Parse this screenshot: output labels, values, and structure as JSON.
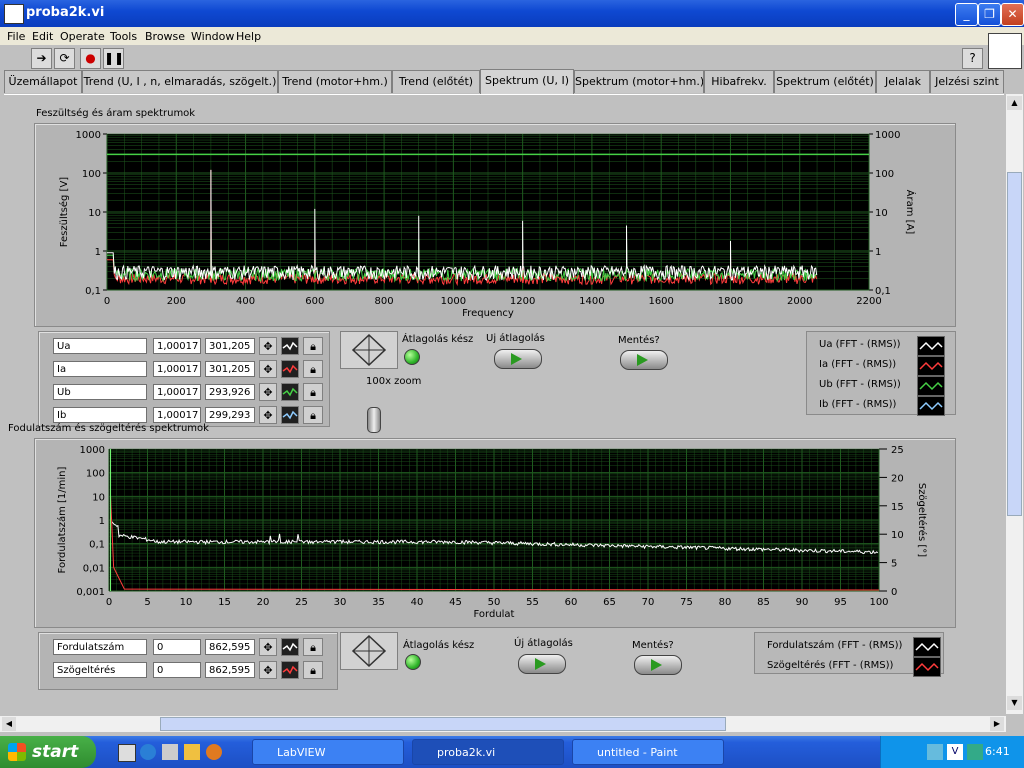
{
  "window": {
    "title": "proba2k.vi"
  },
  "menu": [
    "File",
    "Edit",
    "Operate",
    "Tools",
    "Browse",
    "Window",
    "Help"
  ],
  "tabs": [
    "Üzemállapot",
    "Trend (U, I , n, elmaradás,  szögelt.)",
    "Trend (motor+hm.)",
    "Trend (előtét)",
    "Spektrum (U, I)",
    "Spektrum (motor+hm.)",
    "Hibafrekv.",
    "Spektrum (előtét)",
    "Jelalak",
    "Jelzési szint"
  ],
  "active_tab": "Spektrum (U, I)",
  "top_plot": {
    "title": "Feszültség és áram spektrumok",
    "ylabel_left": "Feszültség [V]",
    "ylabel_right": "Áram [A]",
    "xlabel": "Frequency",
    "y_ticks": [
      "1000",
      "100",
      "10",
      "1",
      "0,1"
    ],
    "x_ticks": [
      "0",
      "200",
      "400",
      "600",
      "800",
      "1000",
      "1200",
      "1400",
      "1600",
      "1800",
      "2000",
      "2200"
    ]
  },
  "top_channels": [
    {
      "name": "Ua",
      "v1": "1,00017",
      "v2": "301,205"
    },
    {
      "name": "Ia",
      "v1": "1,00017",
      "v2": "301,205"
    },
    {
      "name": "Ub",
      "v1": "1,00017",
      "v2": "293,926"
    },
    {
      "name": "Ib",
      "v1": "1,00017",
      "v2": "299,293"
    }
  ],
  "top_controls": {
    "avg_ready": "Átlagolás kész",
    "new_avg": "Uj átlagolás",
    "save": "Mentés?",
    "zoom": "100x zoom"
  },
  "top_legend": [
    "Ua (FFT - (RMS))",
    "Ia (FFT - (RMS))",
    "Ub (FFT - (RMS))",
    "Ib (FFT - (RMS))"
  ],
  "bottom_plot": {
    "title": "Fodulatszám és szögeltérés spektrumok",
    "ylabel_left": "Fordulatszám [1/min]",
    "ylabel_right": "Szögeltérés [°]",
    "xlabel": "Fordulat",
    "y_ticks_left": [
      "1000",
      "100",
      "10",
      "1",
      "0,1",
      "0,01",
      "0,001"
    ],
    "y_ticks_right": [
      "25",
      "20",
      "15",
      "10",
      "5",
      "0"
    ],
    "x_ticks": [
      "0",
      "5",
      "10",
      "15",
      "20",
      "25",
      "30",
      "35",
      "40",
      "45",
      "50",
      "55",
      "60",
      "65",
      "70",
      "75",
      "80",
      "85",
      "90",
      "95",
      "100"
    ]
  },
  "bottom_channels": [
    {
      "name": "Fordulatszám",
      "v1": "0",
      "v2": "862,595"
    },
    {
      "name": "Szögeltérés",
      "v1": "0",
      "v2": "862,595"
    }
  ],
  "bottom_controls": {
    "avg_ready": "Átlagolás kész",
    "new_avg": "Új átlagolás",
    "save": "Mentés?"
  },
  "bottom_legend": [
    "Fordulatszám (FFT - (RMS))",
    "Szögeltérés (FFT - (RMS))"
  ],
  "taskbar": {
    "start": "start",
    "tasks": [
      "LabVIEW",
      "proba2k.vi",
      "untitled - Paint"
    ],
    "lang": "HL",
    "clock": "6:41"
  },
  "colors": {
    "Ua": "#ffffff",
    "Ia": "#ff3c3c",
    "Ub": "#46d046",
    "Ib": "#8ecbff",
    "Fordulatszam": "#ffffff",
    "Szogelteres": "#ff3c3c"
  }
}
